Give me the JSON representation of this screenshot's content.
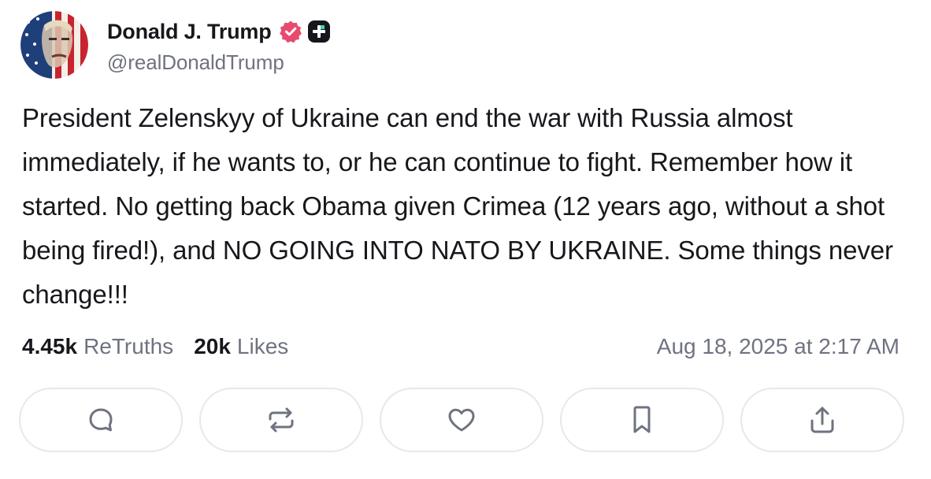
{
  "post": {
    "author": {
      "display_name": "Donald J. Trump",
      "handle": "@realDonaldTrump",
      "verified_icon": "verified-badge-icon",
      "plus_icon": "plus-badge-icon"
    },
    "body": "President Zelenskyy of Ukraine can end the war with Russia almost immediately, if he wants to, or he can continue to fight. Remember how it started. No getting back Obama given Crimea (12 years ago, without a shot being fired!), and NO GOING INTO NATO BY UKRAINE. Some things never change!!!",
    "stats": {
      "retruths_count": "4.45k",
      "retruths_label": "ReTruths",
      "likes_count": "20k",
      "likes_label": "Likes"
    },
    "timestamp": "Aug 18, 2025 at 2:17 AM"
  },
  "actions": [
    {
      "icon": "reply-icon"
    },
    {
      "icon": "retruth-icon"
    },
    {
      "icon": "like-icon"
    },
    {
      "icon": "bookmark-icon"
    },
    {
      "icon": "share-icon"
    }
  ],
  "colors": {
    "text": "#17171c",
    "muted": "#6f7380",
    "verified": "#e84a6f",
    "icon": "#6f7380",
    "border": "#e8e8ec"
  }
}
